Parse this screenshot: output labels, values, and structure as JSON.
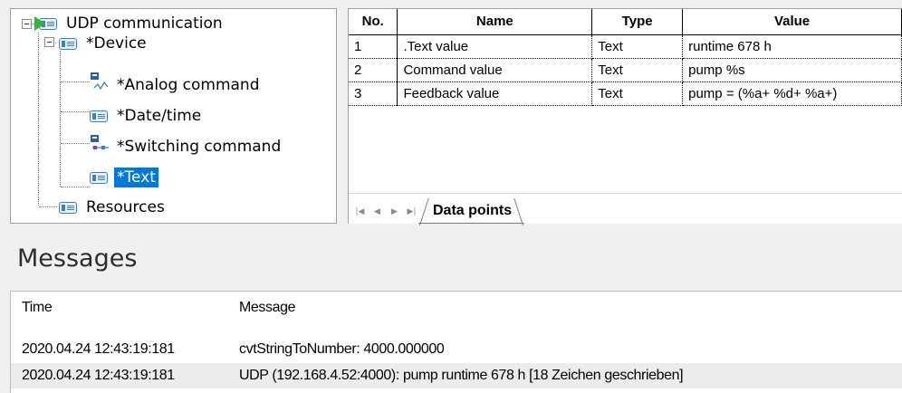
{
  "tree": {
    "root": {
      "label": "UDP communication",
      "icon": "udp-active-icon"
    },
    "device": {
      "label": "*Device",
      "icon": "device-card-icon"
    },
    "children": [
      {
        "label": "*Analog command",
        "icon": "analog-command-icon"
      },
      {
        "label": "*Date/time",
        "icon": "date-time-card-icon"
      },
      {
        "label": "*Switching command",
        "icon": "switching-command-icon"
      },
      {
        "label": "*Text",
        "icon": "text-card-icon",
        "selected": true
      }
    ],
    "resources": {
      "label": "Resources",
      "icon": "resources-card-icon"
    }
  },
  "grid": {
    "columns": [
      "No.",
      "Name",
      "Type",
      "Value"
    ],
    "rows": [
      {
        "no": "1",
        "name": ".Text value",
        "type": "Text",
        "value": "runtime 678 h"
      },
      {
        "no": "2",
        "name": "Command value",
        "type": "Text",
        "value": "pump %s"
      },
      {
        "no": "3",
        "name": "Feedback value",
        "type": "Text",
        "value": "pump = (%a+ %d+ %a+)"
      }
    ],
    "sheet_tab": "Data points",
    "nav_buttons": [
      "first-sheet",
      "previous-sheet",
      "next-sheet",
      "last-sheet"
    ]
  },
  "messages": {
    "title": "Messages",
    "columns": {
      "time": "Time",
      "message": "Message"
    },
    "rows": [
      {
        "time": "2020.04.24 12:43:19:181",
        "message": "cvtStringToNumber: 4000.000000"
      },
      {
        "time": "2020.04.24 12:43:19:181",
        "message": "UDP (192.168.4.52:4000): pump runtime 678 h [18 Zeichen geschrieben]"
      }
    ]
  },
  "colors": {
    "selection": "#0078d7",
    "active_arrow": "#3ab03e",
    "icon_blue": "#3b7fc4",
    "alt_row": "#ececec"
  }
}
